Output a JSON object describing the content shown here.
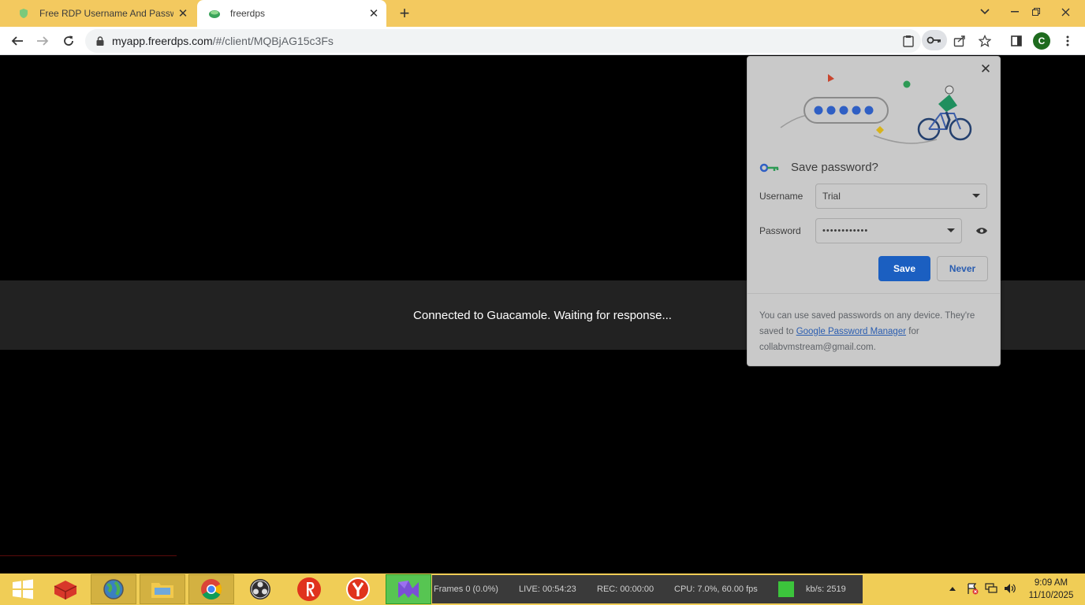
{
  "tabs": [
    {
      "title": "Free RDP Username And Passwo",
      "active": false
    },
    {
      "title": "freerdps",
      "active": true
    }
  ],
  "address_bar": {
    "host": "myapp.freerdps.com",
    "path": "/#/client/MQBjAG15c3Fs"
  },
  "profile_initial": "C",
  "page": {
    "status_message": "Connected to Guacamole. Waiting for response..."
  },
  "password_bubble": {
    "title": "Save password?",
    "username_label": "Username",
    "username_value": "Trial",
    "password_label": "Password",
    "password_value": "••••••••••••",
    "save_label": "Save",
    "never_label": "Never",
    "footer_prefix": "You can use saved passwords on any device. They're saved to",
    "footer_link": "Google Password Manager",
    "footer_suffix": "for",
    "footer_email": "collabvmstream@gmail.com."
  },
  "taskbar": {
    "obs": {
      "frames": "Frames 0 (0.0%)",
      "live": "LIVE: 00:54:23",
      "rec": "REC: 00:00:00",
      "cpu": "CPU: 7.0%, 60.00 fps",
      "kbs": "kb/s: 2519"
    },
    "clock_time": "9:09 AM",
    "clock_date": "11/10/2025"
  },
  "colors": {
    "titlebar": "#f3c95f",
    "taskbar": "#f0cd56",
    "save_button": "#1b5fc1",
    "status_band": "#222222"
  }
}
